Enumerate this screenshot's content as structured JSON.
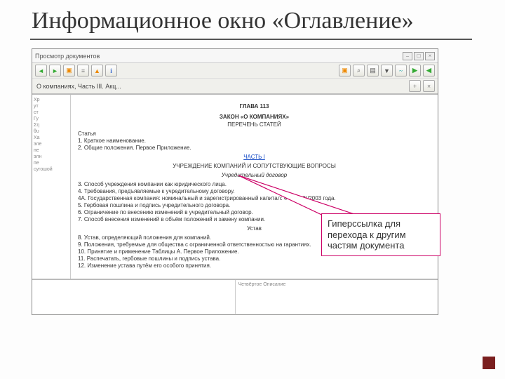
{
  "slide": {
    "title": "Информационное окно «Оглавление»"
  },
  "window": {
    "caption": "Просмотр документов"
  },
  "tabs": {
    "main": "О компаниях, Часть III. Акц..."
  },
  "doc": {
    "chapter": "ГЛАВА 113",
    "title": "ЗАКОН «О КОМПАНИЯХ»",
    "subtitle": "ПЕРЕЧЕНЬ СТАТЕЙ",
    "lines1": [
      "Статья",
      "1. Краткое наименование.",
      "2. Общие положения. Первое Приложение."
    ],
    "part_link": "ЧАСТЬ I",
    "part_title": "УЧРЕЖДЕНИЕ КОМПАНИЙ И СОПУТСТВУЮЩИЕ ВОПРОСЫ",
    "part_sub": "Учредительный договор",
    "lines2": [
      "3. Способ учреждения компании как юридического лица.",
      "4. Требования, предъявляемые к учредительному договору.",
      "4А. Государственная компания: номинальный и зарегистрированный капитал: 4 от 70(I)/2003 года.",
      "5. Гербовая пошлина и подпись учредительного договора.",
      "6. Ограничение по внесению изменений в учредительный договор.",
      "7. Способ внесения изменений в объём положений и замену компании."
    ],
    "ustav": "Устав",
    "lines3": [
      "8. Устав, определяющий положения для компаний.",
      "9. Положения, требуемые для общества с ограниченной ответственностью на гарантиях.",
      "10. Принятие и применение Таблицы А. Первое Приложение.",
      "11. Распечатать, гербовые пошлины и подпись устава.",
      "12. Изменение устава путём его особого принятия."
    ]
  },
  "sidebar": {
    "lines": [
      "Хр",
      "ут",
      "ст",
      "Гу",
      "",
      "Ση",
      "θυ",
      "Ха",
      "",
      "эле",
      "пе",
      "",
      "элн",
      "пе",
      "сугошой"
    ]
  },
  "bottom": {
    "col2": "Четвёртое Описание"
  },
  "callout": {
    "text": "Гиперссылка для перехода к другим частям документа"
  }
}
